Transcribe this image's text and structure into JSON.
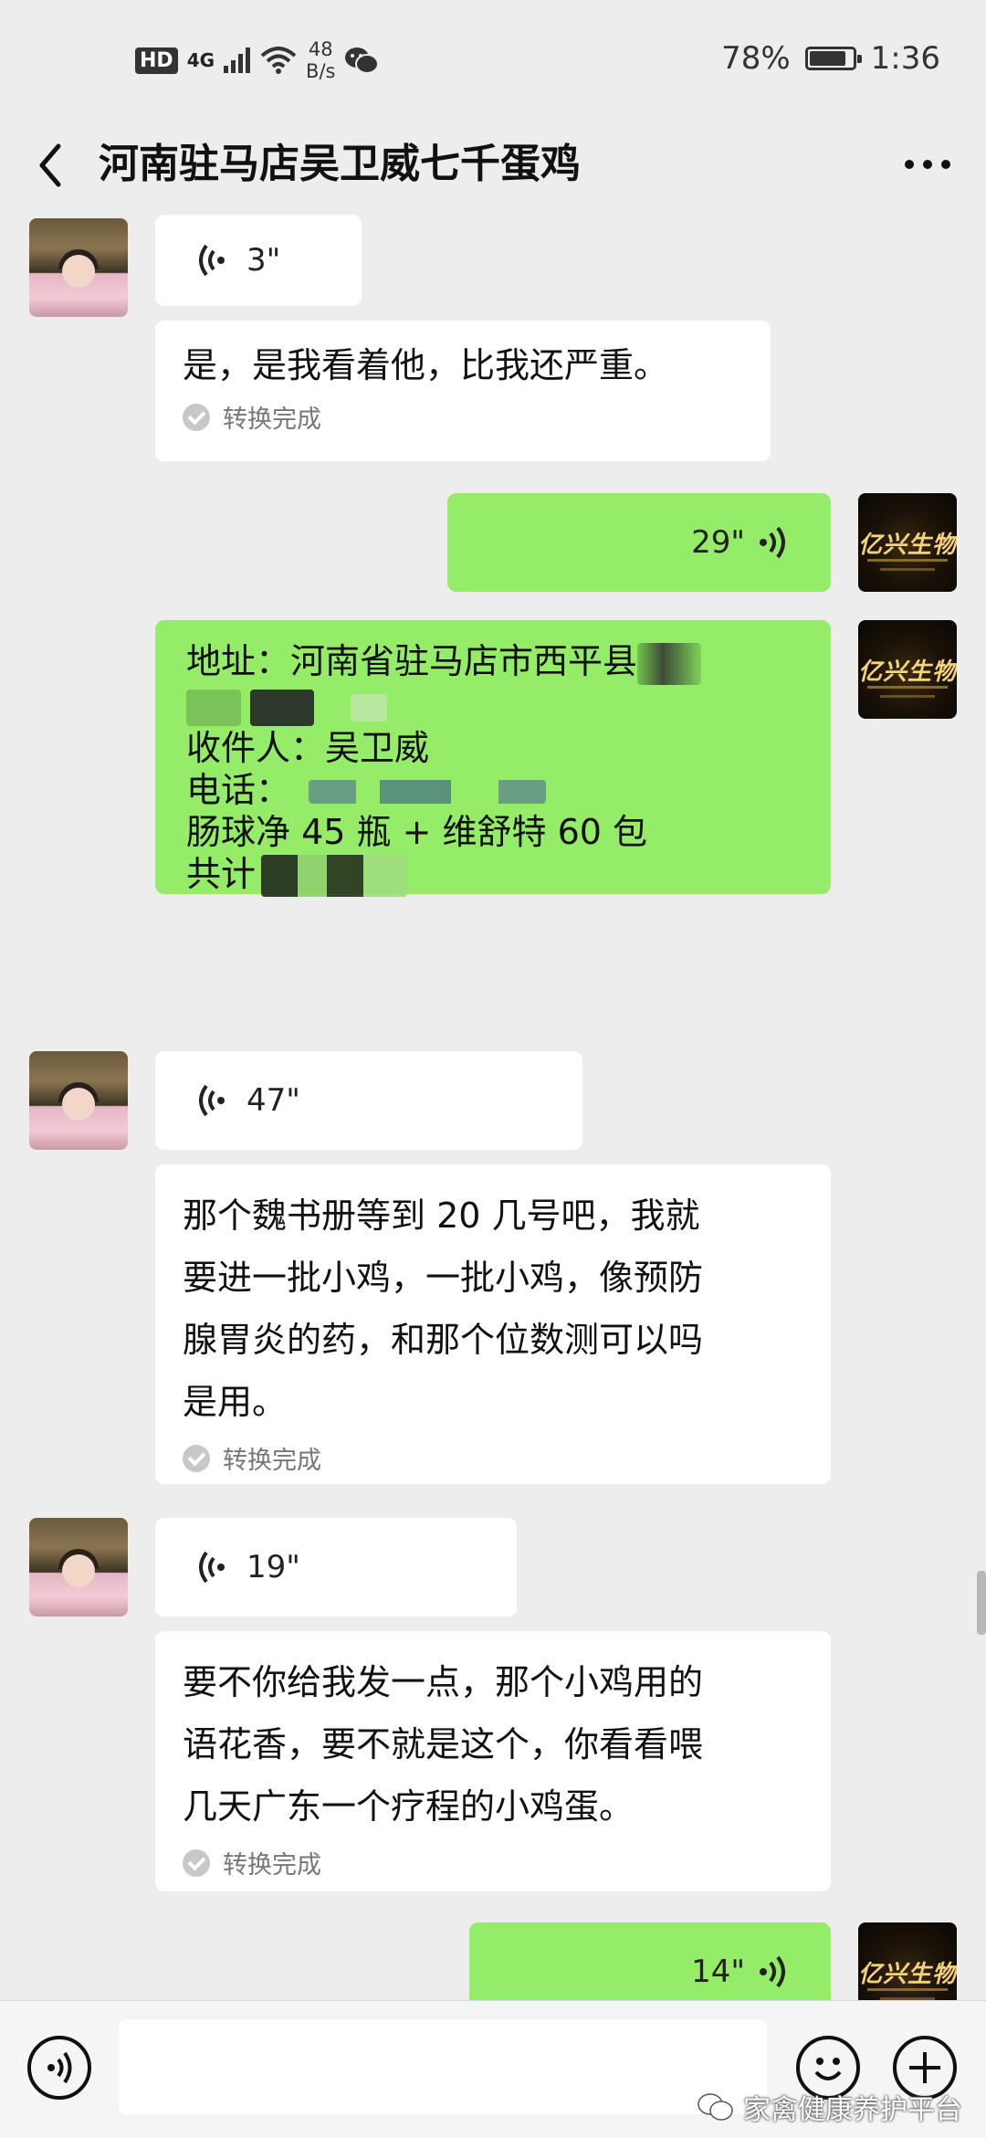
{
  "status_bar": {
    "hd": "HD",
    "network": "4G",
    "speed_value": "48",
    "speed_unit": "B/s",
    "battery": "78%",
    "battery_level": 0.78,
    "time": "1:36"
  },
  "header": {
    "title": "河南驻马店吴卫威七千蛋鸡"
  },
  "messages": [
    {
      "side": "left",
      "type": "voice",
      "duration": "3\""
    },
    {
      "side": "left",
      "type": "transcript",
      "text": "是，是我看着他，比我还严重。",
      "status": "转换完成"
    },
    {
      "side": "right",
      "type": "voice",
      "duration": "29\""
    },
    {
      "side": "right",
      "type": "text",
      "lines": [
        "地址：河南省驻马店市西平县",
        "收件人：吴卫威",
        "电话：",
        "肠球净 45 瓶 + 维舒特 60 包",
        "共计"
      ]
    },
    {
      "side": "left",
      "type": "voice",
      "duration": "47\""
    },
    {
      "side": "left",
      "type": "transcript",
      "lines": [
        "那个魏书册等到 20 几号吧，我就",
        "要进一批小鸡，一批小鸡，像预防",
        "腺胃炎的药，和那个位数测可以吗",
        "是用。"
      ],
      "status": "转换完成"
    },
    {
      "side": "left",
      "type": "voice",
      "duration": "19\""
    },
    {
      "side": "left",
      "type": "transcript",
      "lines": [
        "要不你给我发一点，那个小鸡用的",
        "语花香，要不就是这个，你看看喂",
        "几天广东一个疗程的小鸡蛋。"
      ],
      "status": "转换完成"
    },
    {
      "side": "right",
      "type": "voice",
      "duration": "14\""
    }
  ],
  "contact_avatar": {
    "logo_text": "亿兴生物"
  },
  "icons": {
    "back": "chevron-left-icon",
    "more": "more-dots-icon",
    "voice_toggle": "voice-icon",
    "emoji": "emoji-icon",
    "add": "plus-icon",
    "wechat": "wechat-icon"
  },
  "watermark": {
    "text": "家禽健康养护平台"
  },
  "colors": {
    "background": "#ededed",
    "sent_bubble": "#95ec69",
    "received_bubble": "#ffffff"
  }
}
